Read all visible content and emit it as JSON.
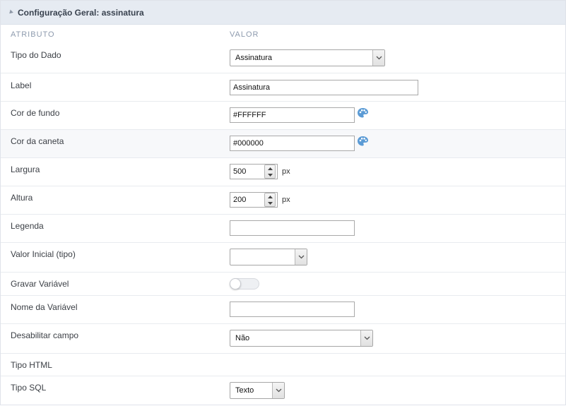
{
  "panel": {
    "title": "Configuração Geral: assinatura"
  },
  "columns": {
    "attribute": "ATRIBUTO",
    "value": "VALOR"
  },
  "fields": {
    "tipo_dado": {
      "label": "Tipo do Dado",
      "value": "Assinatura"
    },
    "label": {
      "label": "Label",
      "value": "Assinatura"
    },
    "cor_fundo": {
      "label": "Cor de fundo",
      "value": "#FFFFFF"
    },
    "cor_caneta": {
      "label": "Cor da caneta",
      "value": "#000000"
    },
    "largura": {
      "label": "Largura",
      "value": "500",
      "unit": "px"
    },
    "altura": {
      "label": "Altura",
      "value": "200",
      "unit": "px"
    },
    "legenda": {
      "label": "Legenda",
      "value": ""
    },
    "valor_inicial": {
      "label": "Valor Inicial (tipo)",
      "value": ""
    },
    "gravar_variavel": {
      "label": "Gravar Variável",
      "on": false
    },
    "nome_variavel": {
      "label": "Nome da Variável",
      "value": ""
    },
    "desabilitar": {
      "label": "Desabilitar campo",
      "value": "Não"
    },
    "tipo_html": {
      "label": "Tipo HTML"
    },
    "tipo_sql": {
      "label": "Tipo SQL",
      "value": "Texto"
    }
  },
  "icons": {
    "palette": "palette-icon",
    "dropdown": "chevron-down-icon"
  },
  "colors": {
    "header_bg": "#e6ebf2",
    "alt_row_bg": "#f7f8fa",
    "palette_blue": "#5b9bd5"
  }
}
